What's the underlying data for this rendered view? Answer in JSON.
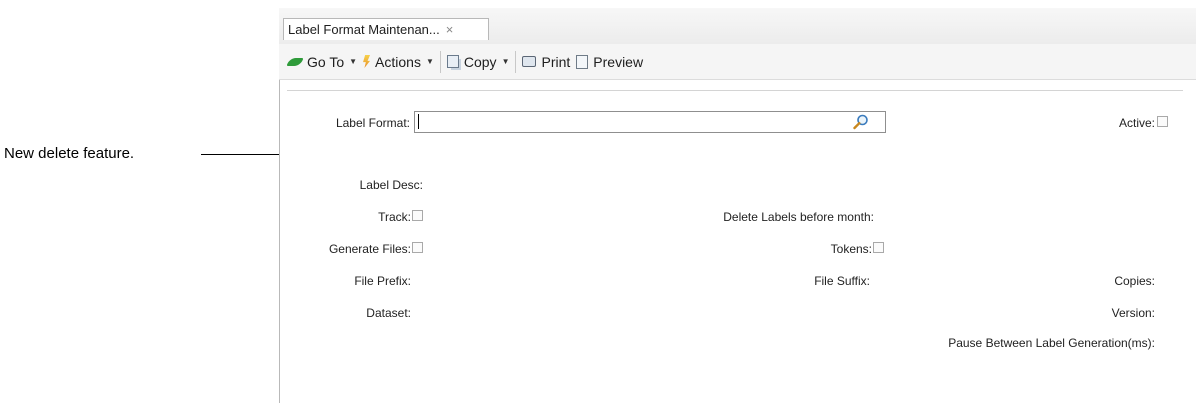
{
  "annotation": {
    "text": "New delete feature."
  },
  "tab": {
    "title": "Label  Format  Maintenan...",
    "close": "×"
  },
  "toolbar": {
    "goto": {
      "label": "Go To",
      "icon": "go-to-icon"
    },
    "actions": {
      "label": "Actions",
      "icon": "actions-lightning-icon"
    },
    "copy": {
      "label": "Copy",
      "icon": "copy-icon"
    },
    "print": {
      "label": "Print",
      "icon": "printer-icon"
    },
    "preview": {
      "label": "Preview",
      "icon": "preview-icon"
    },
    "dropdown_caret": "▼"
  },
  "form": {
    "label_format": {
      "label": "Label Format:",
      "value": ""
    },
    "active": {
      "label": "Active:",
      "checked": false
    },
    "label_desc": {
      "label": "Label Desc:"
    },
    "track": {
      "label": "Track:",
      "checked": false
    },
    "delete_labels": {
      "label": "Delete Labels before month:"
    },
    "generate_files": {
      "label": "Generate Files:",
      "checked": false
    },
    "tokens": {
      "label": "Tokens:",
      "checked": false
    },
    "file_prefix": {
      "label": "File Prefix:"
    },
    "file_suffix": {
      "label": "File Suffix:"
    },
    "copies": {
      "label": "Copies:"
    },
    "dataset": {
      "label": "Dataset:"
    },
    "version": {
      "label": "Version:"
    },
    "pause": {
      "label": "Pause Between Label Generation(ms):"
    }
  }
}
